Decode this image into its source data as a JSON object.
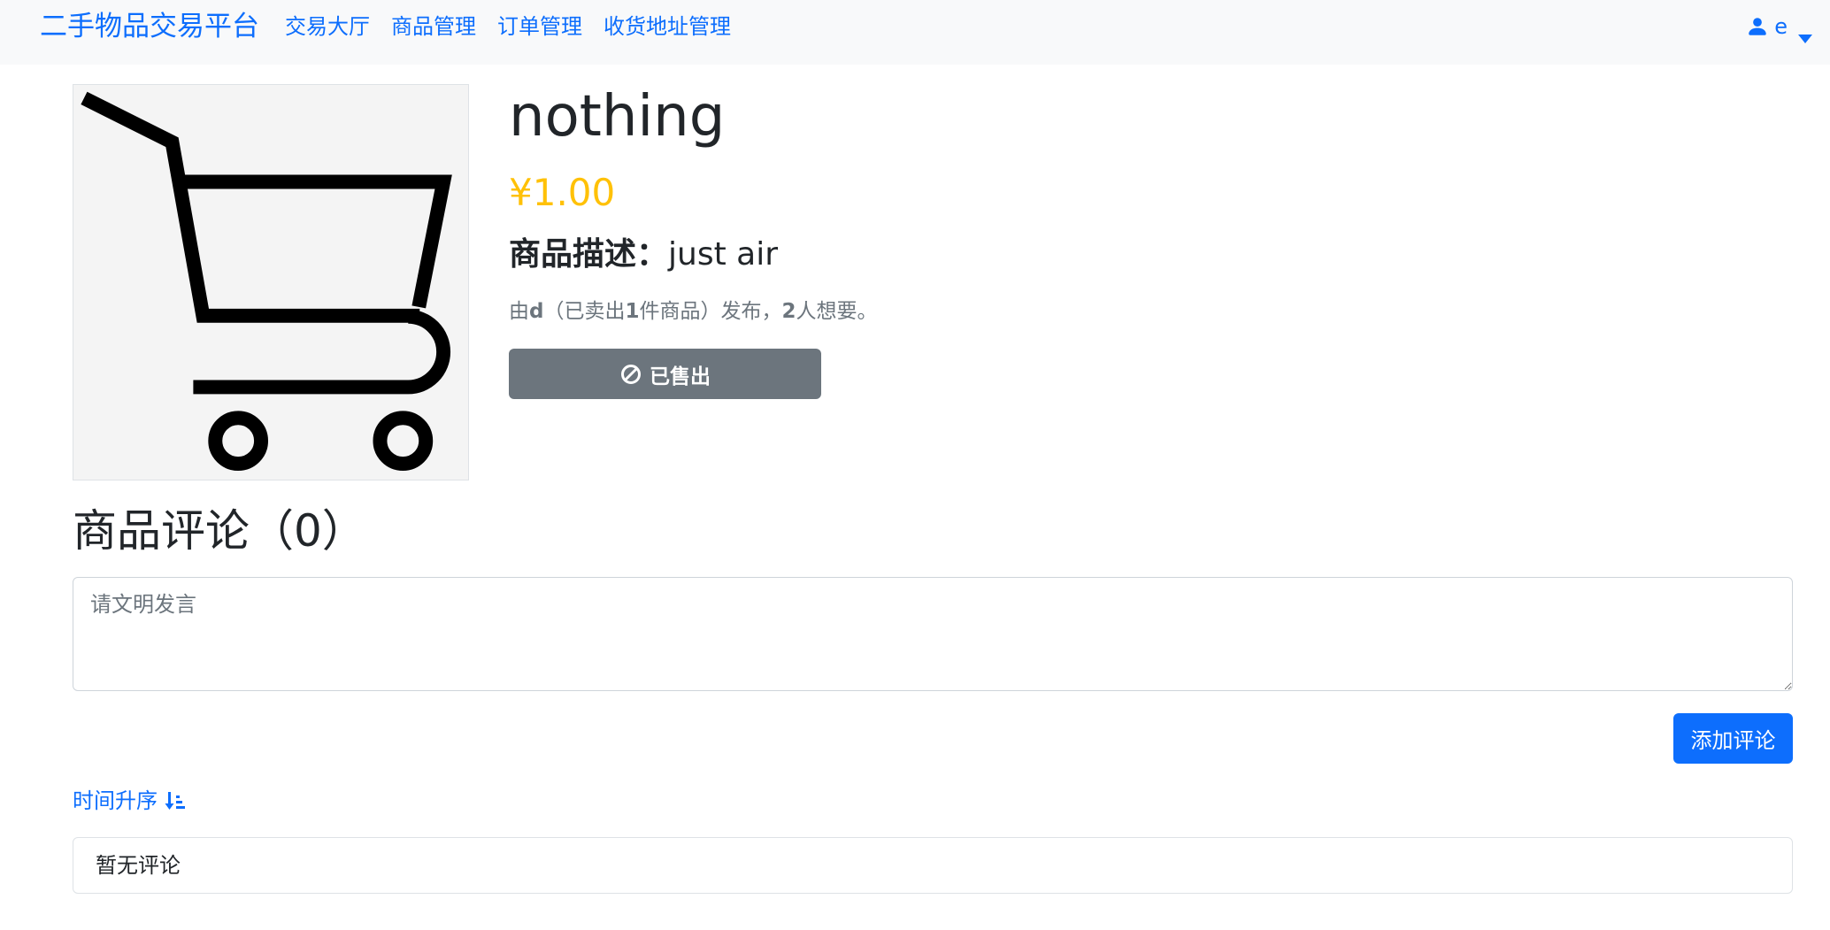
{
  "navbar": {
    "brand": "二手物品交易平台",
    "links": [
      "交易大厅",
      "商品管理",
      "订单管理",
      "收货地址管理"
    ],
    "user": {
      "icon": "person-fill-icon",
      "name": "e",
      "caret_icon": "caret-down-icon"
    }
  },
  "product": {
    "image_icon": "shopping-cart-icon",
    "title": "nothing",
    "price": "¥1.00",
    "description_label": "商品描述：",
    "description": "just air",
    "seller": {
      "prefix": "由",
      "name": "d",
      "sold_prefix": "（已卖出",
      "sold_count": "1",
      "sold_suffix": "件商品）发布，",
      "want_count": "2",
      "want_suffix": "人想要。"
    },
    "status_button": {
      "icon": "ban-icon",
      "label": "已售出"
    }
  },
  "comments": {
    "title": "商品评论（0）",
    "input_placeholder": "请文明发言",
    "input_value": "",
    "add_button": "添加评论",
    "sort_label": "时间升序",
    "sort_icon": "sort-down-icon",
    "empty_text": "暂无评论"
  },
  "colors": {
    "primary": "#0d6efd",
    "price": "#ffc107",
    "secondary": "#6c757d",
    "navbar_bg": "#f8f9fa"
  }
}
